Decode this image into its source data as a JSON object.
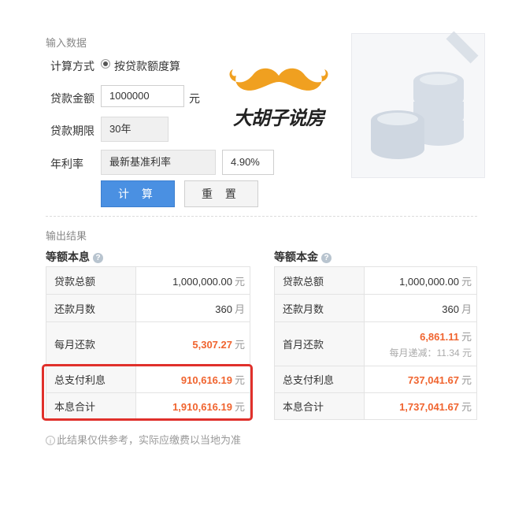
{
  "input": {
    "section_title": "输入数据",
    "calc_method_label": "计算方式",
    "calc_method_option": "按贷款额度算",
    "loan_amount_label": "贷款金额",
    "loan_amount_value": "1000000",
    "loan_amount_unit": "元",
    "loan_term_label": "贷款期限",
    "loan_term_value": "30年",
    "rate_label": "年利率",
    "rate_type_value": "最新基准利率",
    "rate_value": "4.90%",
    "calc_button": "计 算",
    "reset_button": "重 置"
  },
  "logo": {
    "text": "大胡子说房",
    "icon": "mustache-icon"
  },
  "output": {
    "section_title": "输出结果",
    "equal_payment": {
      "title": "等额本息",
      "rows": [
        {
          "key": "贷款总额",
          "value": "1,000,000.00",
          "unit": "元"
        },
        {
          "key": "还款月数",
          "value": "360",
          "unit": "月"
        },
        {
          "key": "每月还款",
          "value": "5,307.27",
          "unit": "元"
        },
        {
          "key": "总支付利息",
          "value": "910,616.19",
          "unit": "元"
        },
        {
          "key": "本息合计",
          "value": "1,910,616.19",
          "unit": "元"
        }
      ]
    },
    "equal_principal": {
      "title": "等额本金",
      "rows": [
        {
          "key": "贷款总额",
          "value": "1,000,000.00",
          "unit": "元"
        },
        {
          "key": "还款月数",
          "value": "360",
          "unit": "月"
        },
        {
          "key": "首月还款",
          "value": "6,861.11",
          "unit": "元",
          "sub": "每月递减：11.34 元"
        },
        {
          "key": "总支付利息",
          "value": "737,041.67",
          "unit": "元"
        },
        {
          "key": "本息合计",
          "value": "1,737,041.67",
          "unit": "元"
        }
      ]
    },
    "disclaimer": "此结果仅供参考，实际应缴费以当地为准"
  },
  "colors": {
    "primary": "#4a90e2",
    "highlight_red": "#f0642f",
    "annotation_box": "#e0302b",
    "logo_gold": "#f0a020"
  }
}
